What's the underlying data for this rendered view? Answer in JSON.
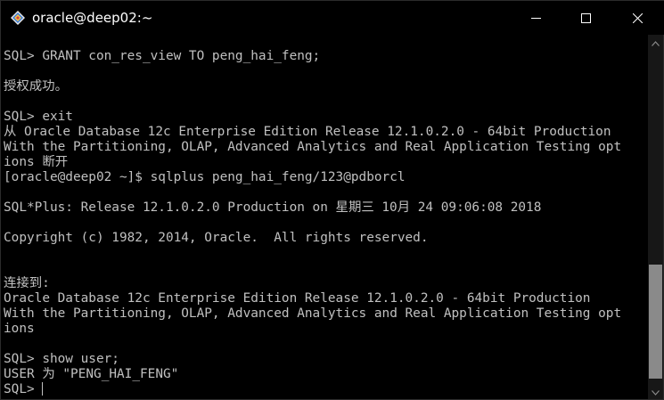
{
  "window": {
    "title": "oracle@deep02:~",
    "icon": "putty-terminal-icon",
    "controls": {
      "minimize": "minimize-icon",
      "maximize": "maximize-icon",
      "close": "close-icon"
    }
  },
  "terminal": {
    "colors": {
      "background": "#000000",
      "foreground": "#c0c0c0",
      "titlebar_text": "#ffffff",
      "scroll_thumb": "#8a8a8a"
    },
    "lines": [
      "SQL> GRANT con_res_view TO peng_hai_feng;",
      "",
      "授权成功。",
      "",
      "SQL> exit",
      "从 Oracle Database 12c Enterprise Edition Release 12.1.0.2.0 - 64bit Production",
      "With the Partitioning, OLAP, Advanced Analytics and Real Application Testing opt",
      "ions 断开",
      "[oracle@deep02 ~]$ sqlplus peng_hai_feng/123@pdborcl",
      "",
      "SQL*Plus: Release 12.1.0.2.0 Production on 星期三 10月 24 09:06:08 2018",
      "",
      "Copyright (c) 1982, 2014, Oracle.  All rights reserved.",
      "",
      "",
      "连接到:",
      "Oracle Database 12c Enterprise Edition Release 12.1.0.2.0 - 64bit Production",
      "With the Partitioning, OLAP, Advanced Analytics and Real Application Testing opt",
      "ions",
      "",
      "SQL> show user;",
      "USER 为 \"PENG_HAI_FENG\"",
      "SQL> "
    ]
  }
}
